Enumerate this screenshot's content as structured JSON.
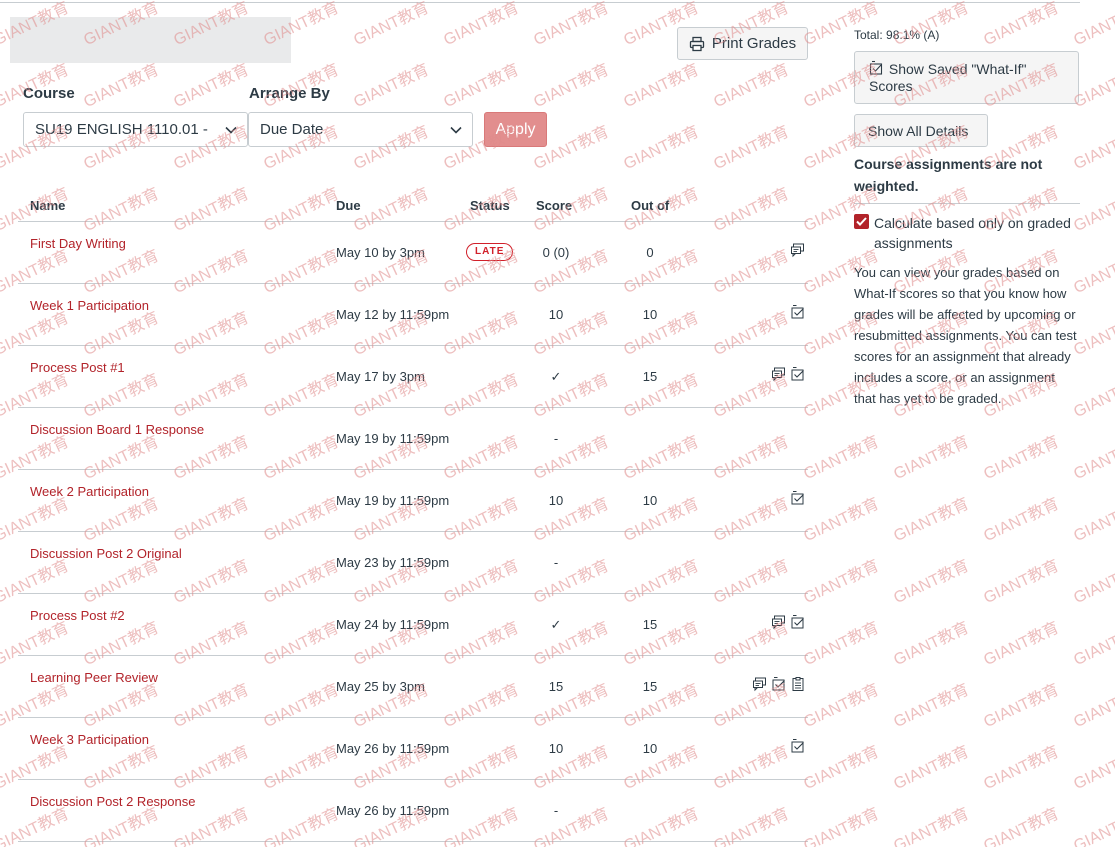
{
  "toolbar": {
    "print_label": "Print Grades"
  },
  "filters": {
    "course_label": "Course",
    "course_value": "SU19 ENGLISH 1110.01 -",
    "arrange_label": "Arrange By",
    "arrange_value": "Due Date",
    "apply_label": "Apply"
  },
  "table": {
    "headers": {
      "name": "Name",
      "due": "Due",
      "status": "Status",
      "score": "Score",
      "out_of": "Out of"
    },
    "rows": [
      {
        "name": "First Day Writing",
        "due": "May 10 by 3pm",
        "status": "LATE",
        "score": "0 (0)",
        "out_of": "0",
        "icons": [
          "comment-icon"
        ]
      },
      {
        "name": "Week 1 Participation",
        "due": "May 12 by 11:59pm",
        "status": "",
        "score": "10",
        "out_of": "10",
        "icons": [
          "whatif-icon"
        ]
      },
      {
        "name": "Process Post #1",
        "due": "May 17 by 3pm",
        "status": "",
        "score": "✓",
        "out_of": "15",
        "icons": [
          "comment-icon",
          "whatif-icon"
        ]
      },
      {
        "name": "Discussion Board 1 Response",
        "due": "May 19 by 11:59pm",
        "status": "",
        "score": "-",
        "out_of": "",
        "icons": []
      },
      {
        "name": "Week 2 Participation",
        "due": "May 19 by 11:59pm",
        "status": "",
        "score": "10",
        "out_of": "10",
        "icons": [
          "whatif-icon"
        ]
      },
      {
        "name": "Discussion Post 2 Original",
        "due": "May 23 by 11:59pm",
        "status": "",
        "score": "-",
        "out_of": "",
        "icons": []
      },
      {
        "name": "Process Post #2",
        "due": "May 24 by 11:59pm",
        "status": "",
        "score": "✓",
        "out_of": "15",
        "icons": [
          "comment-icon",
          "whatif-icon"
        ]
      },
      {
        "name": "Learning Peer Review",
        "due": "May 25 by 3pm",
        "status": "",
        "score": "15",
        "out_of": "15",
        "icons": [
          "comment-icon",
          "whatif-icon",
          "rubric-icon"
        ]
      },
      {
        "name": "Week 3 Participation",
        "due": "May 26 by 11:59pm",
        "status": "",
        "score": "10",
        "out_of": "10",
        "icons": [
          "whatif-icon"
        ]
      },
      {
        "name": "Discussion Post 2 Response",
        "due": "May 26 by 11:59pm",
        "status": "",
        "score": "-",
        "out_of": "",
        "icons": []
      }
    ]
  },
  "sidebar": {
    "total": "Total: 98.1% (A)",
    "whatif_label": "Show Saved \"What-If\" Scores",
    "details_label": "Show All Details",
    "not_weighted": "Course assignments are not weighted.",
    "checkbox_label": "Calculate based only on graded assignments",
    "checkbox_checked": true,
    "info": "You can view your grades based on What-If scores so that you know how grades will be affected by upcoming or resubmitted assignments. You can test scores for an assignment that already includes a score, or an assignment that has yet to be graded."
  },
  "watermark": {
    "text": "GIANT教育"
  },
  "colors": {
    "accent": "#b2232a",
    "apply_bg": "#e28e8e",
    "border": "#c7cdd1",
    "watermark": "#e08c8c"
  }
}
